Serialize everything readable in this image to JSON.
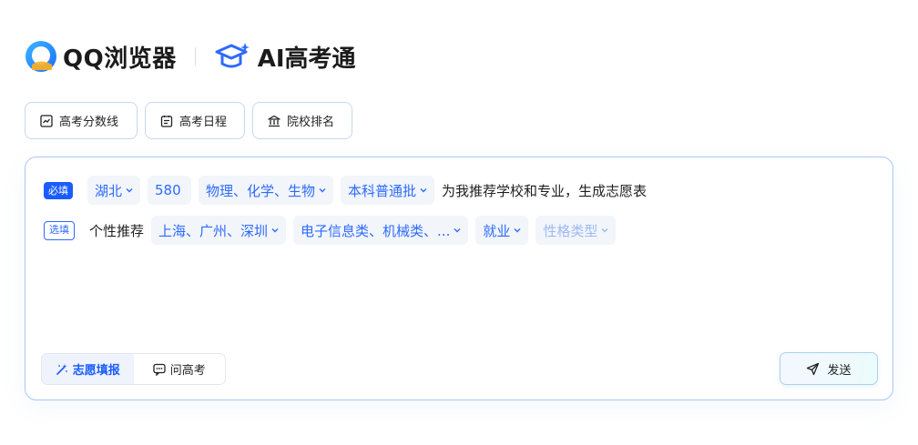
{
  "brand": {
    "browser_name": "QQ浏览器",
    "product_name": "AI高考通"
  },
  "quick_links": [
    {
      "label": "高考分数线",
      "icon": "trend-chart-icon"
    },
    {
      "label": "高考日程",
      "icon": "calendar-clipboard-icon"
    },
    {
      "label": "院校排名",
      "icon": "bank-building-icon"
    }
  ],
  "form": {
    "required_badge": "必填",
    "optional_badge": "选填",
    "province": "湖北",
    "score": "580",
    "subjects": "物理、化学、生物",
    "batch": "本科普通批",
    "prompt_suffix": "为我推荐学校和专业，生成志愿表",
    "personalize_label": "个性推荐",
    "regions": "上海、广州、深圳",
    "majors": "电子信息类、机械类、...",
    "goal": "就业",
    "personality_placeholder": "性格类型"
  },
  "modes": [
    {
      "label": "志愿填报",
      "icon": "magic-wand-icon",
      "active": true
    },
    {
      "label": "问高考",
      "icon": "chat-bubble-icon",
      "active": false
    }
  ],
  "send_label": "发送",
  "colors": {
    "accent": "#1a5cff",
    "chip_bg": "#f2f5fa",
    "card_border": "#a9c8f6"
  }
}
